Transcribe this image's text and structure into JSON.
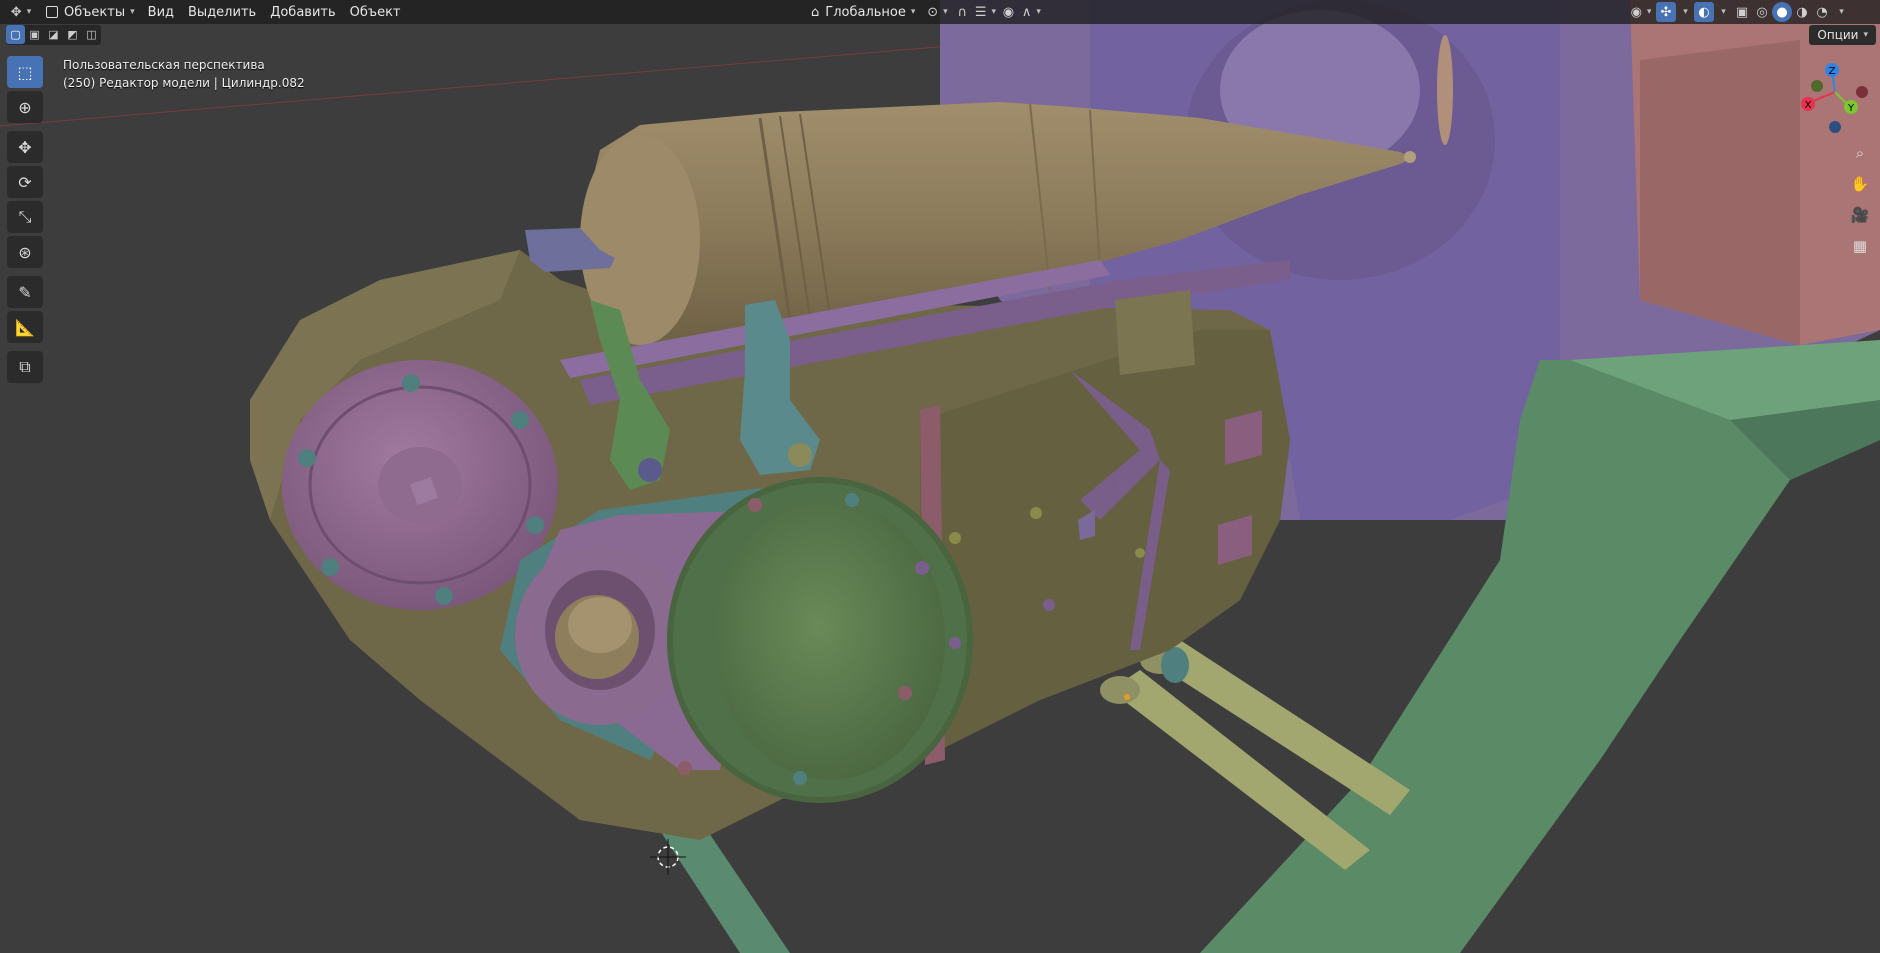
{
  "header": {
    "editor_type_icon": "3d-viewport-icon",
    "mode": "Объекты",
    "menus": [
      "Вид",
      "Выделить",
      "Добавить",
      "Объект"
    ],
    "transform_orientation": "Глобальное",
    "pivot_icon": "pivot-point-icon",
    "snap_icon": "magnet-icon",
    "proportional_icon": "proportional-edit-icon"
  },
  "toolbar": {
    "tools": [
      {
        "name": "select-box-icon",
        "active": true
      },
      {
        "name": "cursor-icon"
      },
      {
        "name": "move-icon"
      },
      {
        "name": "rotate-icon"
      },
      {
        "name": "scale-icon"
      },
      {
        "name": "transform-icon"
      },
      {
        "name": "annotate-icon"
      },
      {
        "name": "measure-icon"
      },
      {
        "name": "add-cube-icon"
      }
    ]
  },
  "overlay": {
    "view_name": "Пользовательская перспектива",
    "context": "(250) Редактор модели | Цилиндр.082"
  },
  "options_label": "Опции",
  "gizmo": {
    "z": "Z",
    "x": "X",
    "y": "Y",
    "colors": {
      "x": "#e8314d",
      "y": "#7ac72e",
      "z": "#2e84e6"
    }
  },
  "colors": {
    "background": "#3d3d3d",
    "accent": "#4772b3",
    "body_olive": "#6f6848",
    "shell_tan": "#8a7a5d",
    "purple_part": "#8d6a8e",
    "green_part": "#557a56",
    "teal_part": "#4f7f7e",
    "lavender_part": "#7a6a9a"
  }
}
